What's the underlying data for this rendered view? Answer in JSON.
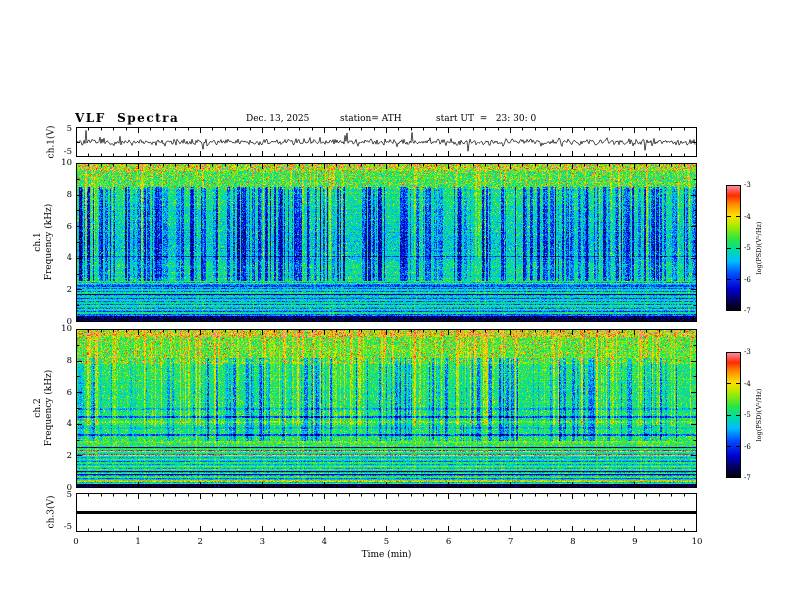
{
  "header": {
    "title": "VLF  Spectra",
    "date": "Dec. 13, 2025",
    "station": "station= ATH",
    "start_ut": "start UT  =   23: 30: 0"
  },
  "xaxis": {
    "label": "Time  (min)",
    "min": 0,
    "max": 10,
    "ticks": [
      "0",
      "1",
      "2",
      "3",
      "4",
      "5",
      "6",
      "7",
      "8",
      "9",
      "10"
    ]
  },
  "chart_data": [
    {
      "id": "ch1_waveform",
      "type": "line",
      "ylabel": "ch.1(V)",
      "ylim": [
        -5,
        5
      ],
      "yticks": [
        "5",
        "-5"
      ],
      "xlim": [
        0,
        10
      ],
      "description": "continuous broadband noise waveform, mostly within ±2 V with frequent impulsive spikes reaching about ±4 V over the full 10 minutes"
    },
    {
      "id": "ch1_spectrogram",
      "type": "heatmap",
      "ylabel_line1": "ch.1",
      "ylabel_line2": "Frequency (kHz)",
      "ylim": [
        0,
        10
      ],
      "yticks": [
        "10",
        "8",
        "6",
        "4",
        "2",
        "0"
      ],
      "xlim": [
        0,
        10
      ],
      "zlabel": "log(PSD)(V²/Hz)",
      "zrange": [
        -7,
        -3
      ],
      "description": "green/cyan background near log PSD ≈ -5; dense dark-blue vertical dropout streaks between ~2.5 and 8.5 kHz (sferics/impulses); yellow-orange speckle above ~8.5 kHz with red points near 10 kHz; horizontal striped cyan/blue bands with dark rows below ~2.5 kHz; solid black band at 0-0.3 kHz; narrow persistent horizontal lines near 3.5 and 4.1 kHz"
    },
    {
      "id": "ch2_spectrogram",
      "type": "heatmap",
      "ylabel_line1": "ch.2",
      "ylabel_line2": "Frequency (kHz)",
      "ylim": [
        0,
        10
      ],
      "yticks": [
        "10",
        "8",
        "6",
        "4",
        "2",
        "0"
      ],
      "xlim": [
        0,
        10
      ],
      "zlabel": "log(PSD)(V²/Hz)",
      "zrange": [
        -7,
        -3
      ],
      "description": "greener/brighter than ch.1 with more yellow vertical streaks; blue dropout streaks 3-8 kHz; many narrow horizontal lines between ~3 and 5 kHz; striped band below ~2.6 kHz including orange/red hot rows near 1.7-2 kHz; solid black band at 0-0.3 kHz"
    },
    {
      "id": "ch3_waveform",
      "type": "line",
      "ylabel": "ch.3(V)",
      "ylim": [
        -5,
        5
      ],
      "yticks": [
        "5",
        "-5"
      ],
      "xlim": [
        0,
        10
      ],
      "description": "flat thick black trace at 0 V for the whole interval (no signal on channel 3)"
    }
  ],
  "colorbars": [
    {
      "label": "log(PSD)(V²/Hz)",
      "ticks": [
        "-3",
        "-4",
        "-5",
        "-6",
        "-7"
      ],
      "range": [
        -7,
        -3
      ]
    },
    {
      "label": "log(PSD)(V²/Hz)",
      "ticks": [
        "-3",
        "-4",
        "-5",
        "-6",
        "-7"
      ],
      "range": [
        -7,
        -3
      ]
    }
  ],
  "colors": {
    "background": "#ffffff",
    "frame": "#000000",
    "trace": "#000000",
    "colormap": "black-blue-cyan-green-yellow-orange-red-pink"
  }
}
